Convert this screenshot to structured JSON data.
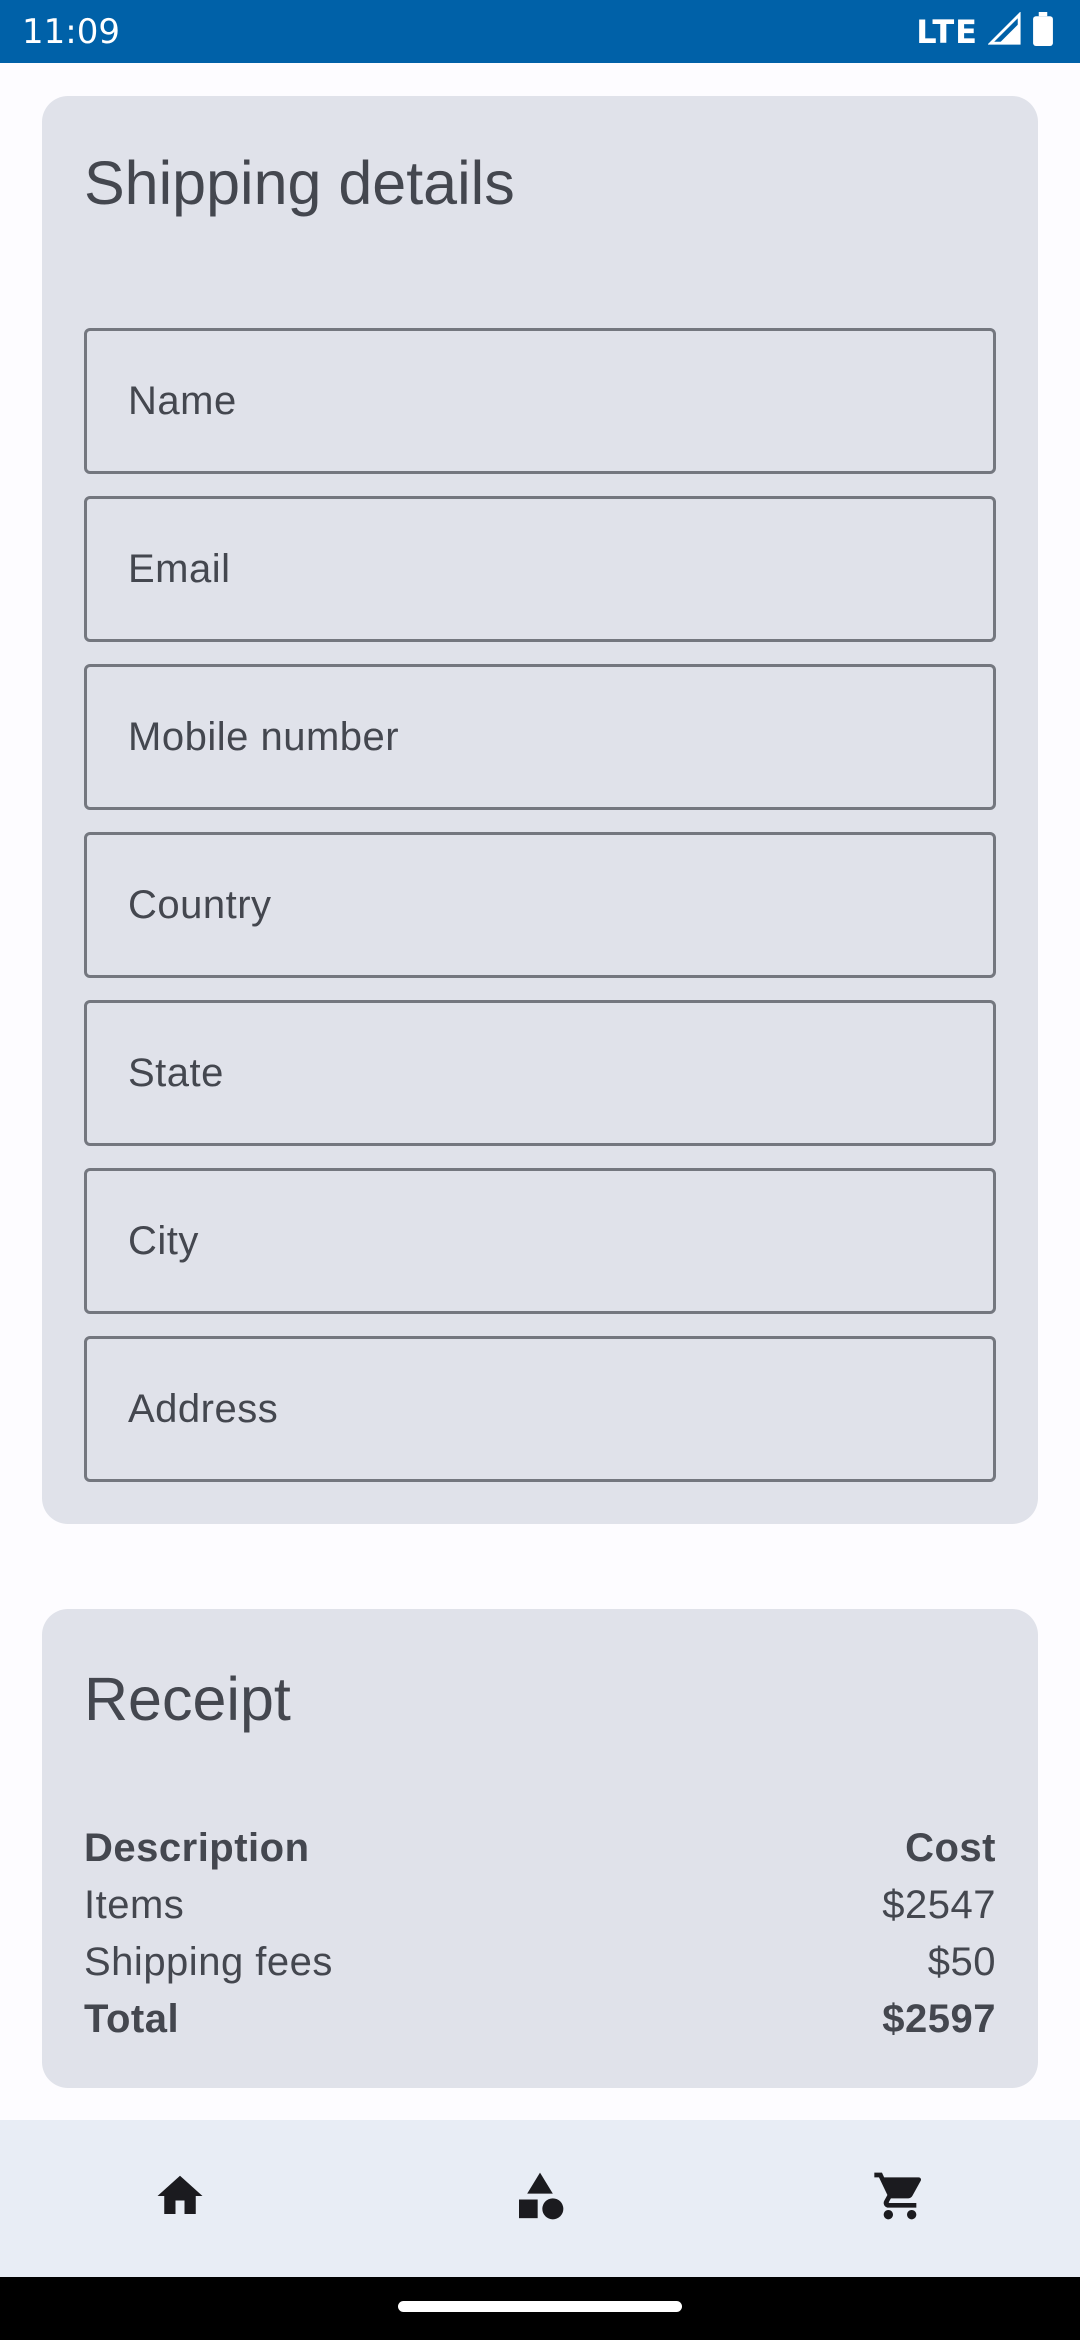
{
  "status_bar": {
    "time": "11:09",
    "network": "LTE",
    "background_color": "#0061a8"
  },
  "shipping": {
    "title": "Shipping details",
    "fields": [
      {
        "label": "Name"
      },
      {
        "label": "Email"
      },
      {
        "label": "Mobile number"
      },
      {
        "label": "Country"
      },
      {
        "label": "State"
      },
      {
        "label": "City"
      },
      {
        "label": "Address"
      }
    ]
  },
  "receipt": {
    "title": "Receipt",
    "header": {
      "description": "Description",
      "cost": "Cost"
    },
    "rows": [
      {
        "description": "Items",
        "cost": "$2547"
      },
      {
        "description": "Shipping fees",
        "cost": "$50"
      }
    ],
    "total": {
      "description": "Total",
      "cost": "$2597"
    }
  },
  "bottom_nav": {
    "items": [
      {
        "icon": "home-icon"
      },
      {
        "icon": "category-icon"
      },
      {
        "icon": "cart-icon"
      }
    ]
  }
}
